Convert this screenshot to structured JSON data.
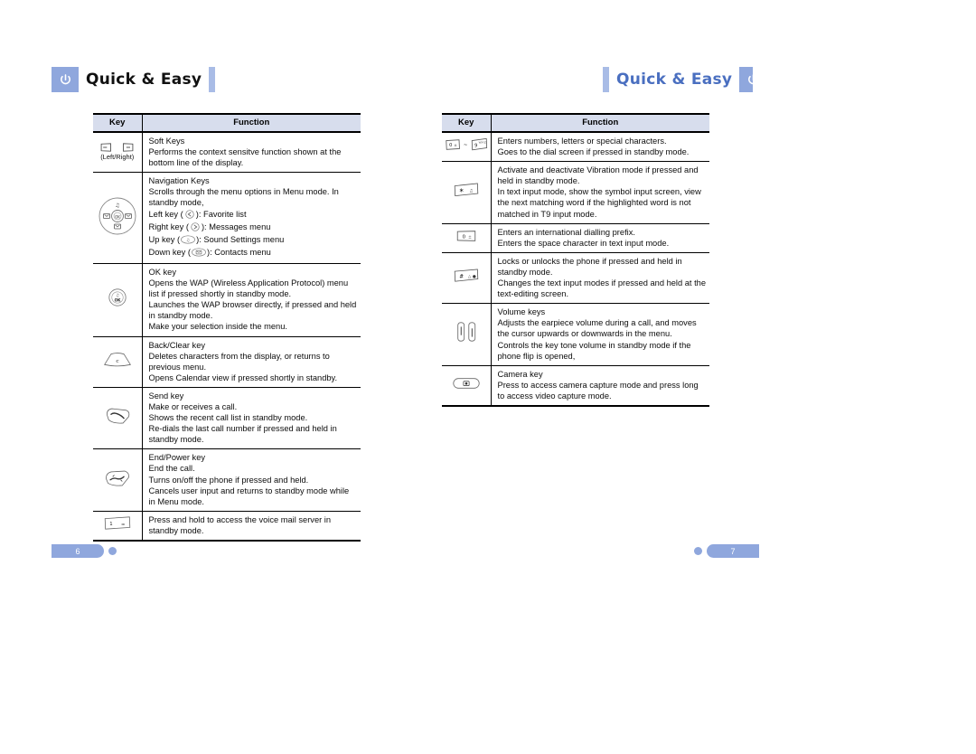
{
  "document": {
    "left_page": {
      "header": {
        "title": "Quick & Easy",
        "power_icon": "power-icon"
      },
      "page_number": "6",
      "table": {
        "columns": [
          "Key",
          "Function"
        ],
        "rows": [
          {
            "key_icon": "soft-keys-icon",
            "key_caption": "(Left/Right)",
            "lines": [
              "Soft Keys",
              "Performs the context sensitve function shown at the bottom line of the display."
            ]
          },
          {
            "key_icon": "navigation-keys-icon",
            "key_caption": "",
            "lines": [
              "Navigation Keys",
              "Scrolls through the menu options in Menu mode. In standby mode,",
              "Left key (   ): Favorite list",
              "Right key (   ): Messages menu",
              "Up key (   ): Sound Settings menu",
              "Down key (   ): Contacts menu"
            ]
          },
          {
            "key_icon": "ok-key-icon",
            "key_caption": "",
            "lines": [
              "OK key",
              "Opens the WAP (Wireless Application Protocol) menu list if pressed shortly in standby mode.",
              "Launches the WAP browser directly, if pressed and held in standby mode.",
              "Make your selection inside the menu."
            ]
          },
          {
            "key_icon": "back-clear-key-icon",
            "key_caption": "",
            "lines": [
              "Back/Clear key",
              "Deletes characters from the display, or returns to previous menu.",
              "Opens Calendar view if pressed shortly in standby."
            ]
          },
          {
            "key_icon": "send-key-icon",
            "key_caption": "",
            "lines": [
              "Send key",
              "Make or receives a call.",
              "Shows the recent call list in standby mode.",
              "Re-dials the last call number if pressed and held in standby mode."
            ]
          },
          {
            "key_icon": "end-power-key-icon",
            "key_caption": "",
            "lines": [
              "End/Power key",
              "End the call.",
              "Turns on/off the phone if pressed and held.",
              "Cancels user input and returns to standby mode while in Menu mode."
            ]
          },
          {
            "key_icon": "voicemail-key-icon",
            "key_caption": "",
            "lines": [
              "Press and hold to access the voice mail server in standby mode."
            ]
          }
        ]
      }
    },
    "right_page": {
      "header": {
        "title": "Quick & Easy",
        "power_icon": "power-icon"
      },
      "page_number": "7",
      "table": {
        "columns": [
          "Key",
          "Function"
        ],
        "rows": [
          {
            "key_icon": "number-keys-range-icon",
            "key_caption": "",
            "lines": [
              "Enters numbers, letters or special characters.",
              "Goes to the dial screen if pressed in standby mode."
            ]
          },
          {
            "key_icon": "star-key-icon",
            "key_caption": "",
            "lines": [
              "Activate and deactivate Vibration mode if pressed and held in standby mode.",
              "In text input mode, show the symbol input screen, view the next matching word if the highlighted word is not matched in T9 input mode."
            ]
          },
          {
            "key_icon": "zero-key-icon",
            "key_caption": "",
            "lines": [
              "Enters an international dialling prefix.",
              "Enters the space character in text input mode."
            ]
          },
          {
            "key_icon": "hash-key-icon",
            "key_caption": "",
            "lines": [
              "Locks or unlocks the phone if pressed and held in standby mode.",
              "Changes the text input modes if pressed and held at the text-editing screen."
            ]
          },
          {
            "key_icon": "volume-keys-icon",
            "key_caption": "",
            "lines": [
              "Volume keys",
              "Adjusts the earpiece volume during a call, and moves the cursor upwards or downwards in the menu.",
              "Controls the key tone volume in standby mode if the phone flip is opened,"
            ]
          },
          {
            "key_icon": "camera-key-icon",
            "key_caption": "",
            "lines": [
              "Camera key",
              "Press to access camera capture mode and press long to access video capture mode."
            ]
          }
        ]
      }
    },
    "colors": {
      "accent": "#8fa7dd",
      "header_title_right": "#4a6fc0",
      "table_header_bg": "#d7dded"
    }
  }
}
